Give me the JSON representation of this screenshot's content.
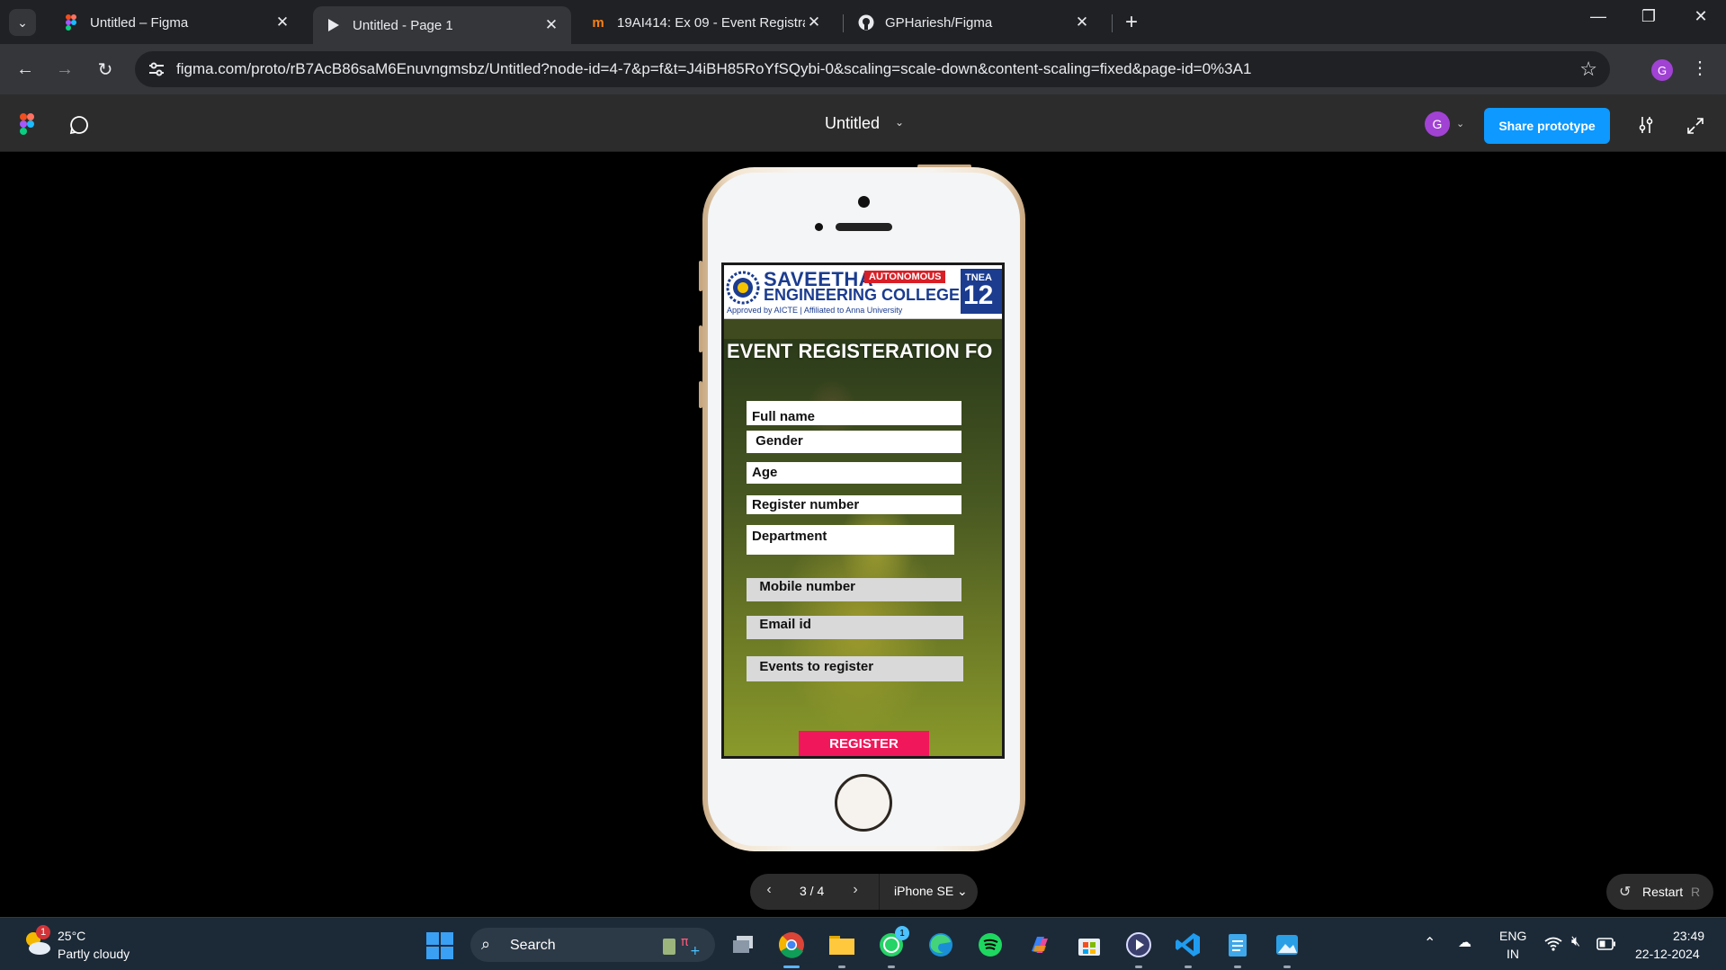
{
  "browser": {
    "tabs": [
      {
        "title": "Untitled – Figma",
        "favicon": "figma-icon",
        "active": false
      },
      {
        "title": "Untitled - Page 1",
        "favicon": "play-icon",
        "active": true
      },
      {
        "title": "19AI414: Ex 09 - Event Registrat",
        "favicon": "moodle-icon",
        "active": false
      },
      {
        "title": "GPHariesh/Figma",
        "favicon": "github-icon",
        "active": false
      }
    ],
    "url": "figma.com/proto/rB7AcB86saM6Enuvngmsbz/Untitled?node-id=4-7&p=f&t=J4iBH85RoYfSQybi-0&scaling=scale-down&content-scaling=fixed&page-id=0%3A1",
    "profile_initial": "G"
  },
  "figma": {
    "file_title": "Untitled",
    "user_initial": "G",
    "share_label": "Share prototype",
    "accent": "#0d99ff"
  },
  "prototype": {
    "college": {
      "line1": "SAVEETHA",
      "badge": "AUTONOMOUS",
      "line2": "ENGINEERING COLLEGE",
      "approved": "Approved by AICTE | Affiliated to Anna University",
      "tnea_label": "TNEA",
      "tnea_code": "12"
    },
    "form_title": "EVENT REGISTERATION FO",
    "fields": [
      {
        "label": "Full name",
        "style": "white"
      },
      {
        "label": " Gender",
        "style": "white"
      },
      {
        "label": "Age",
        "style": "white"
      },
      {
        "label": "Register number",
        "style": "white"
      },
      {
        "label": "Department",
        "style": "white"
      },
      {
        "label": "  Mobile number",
        "style": "grey"
      },
      {
        "label": "  Email id",
        "style": "grey"
      },
      {
        "label": "  Events to register",
        "style": "grey"
      }
    ],
    "register_label": "REGISTER",
    "register_color": "#f0185a"
  },
  "proto_controls": {
    "page": "3 / 4",
    "device": "iPhone SE",
    "restart_label": "Restart",
    "restart_key": "R"
  },
  "taskbar": {
    "weather_temp": "25°C",
    "weather_desc": "Partly cloudy",
    "weather_badge": "1",
    "search_label": "Search",
    "whatsapp_badge": "1",
    "lang_line1": "ENG",
    "lang_line2": "IN",
    "time": "23:49",
    "date": "22-12-2024"
  }
}
